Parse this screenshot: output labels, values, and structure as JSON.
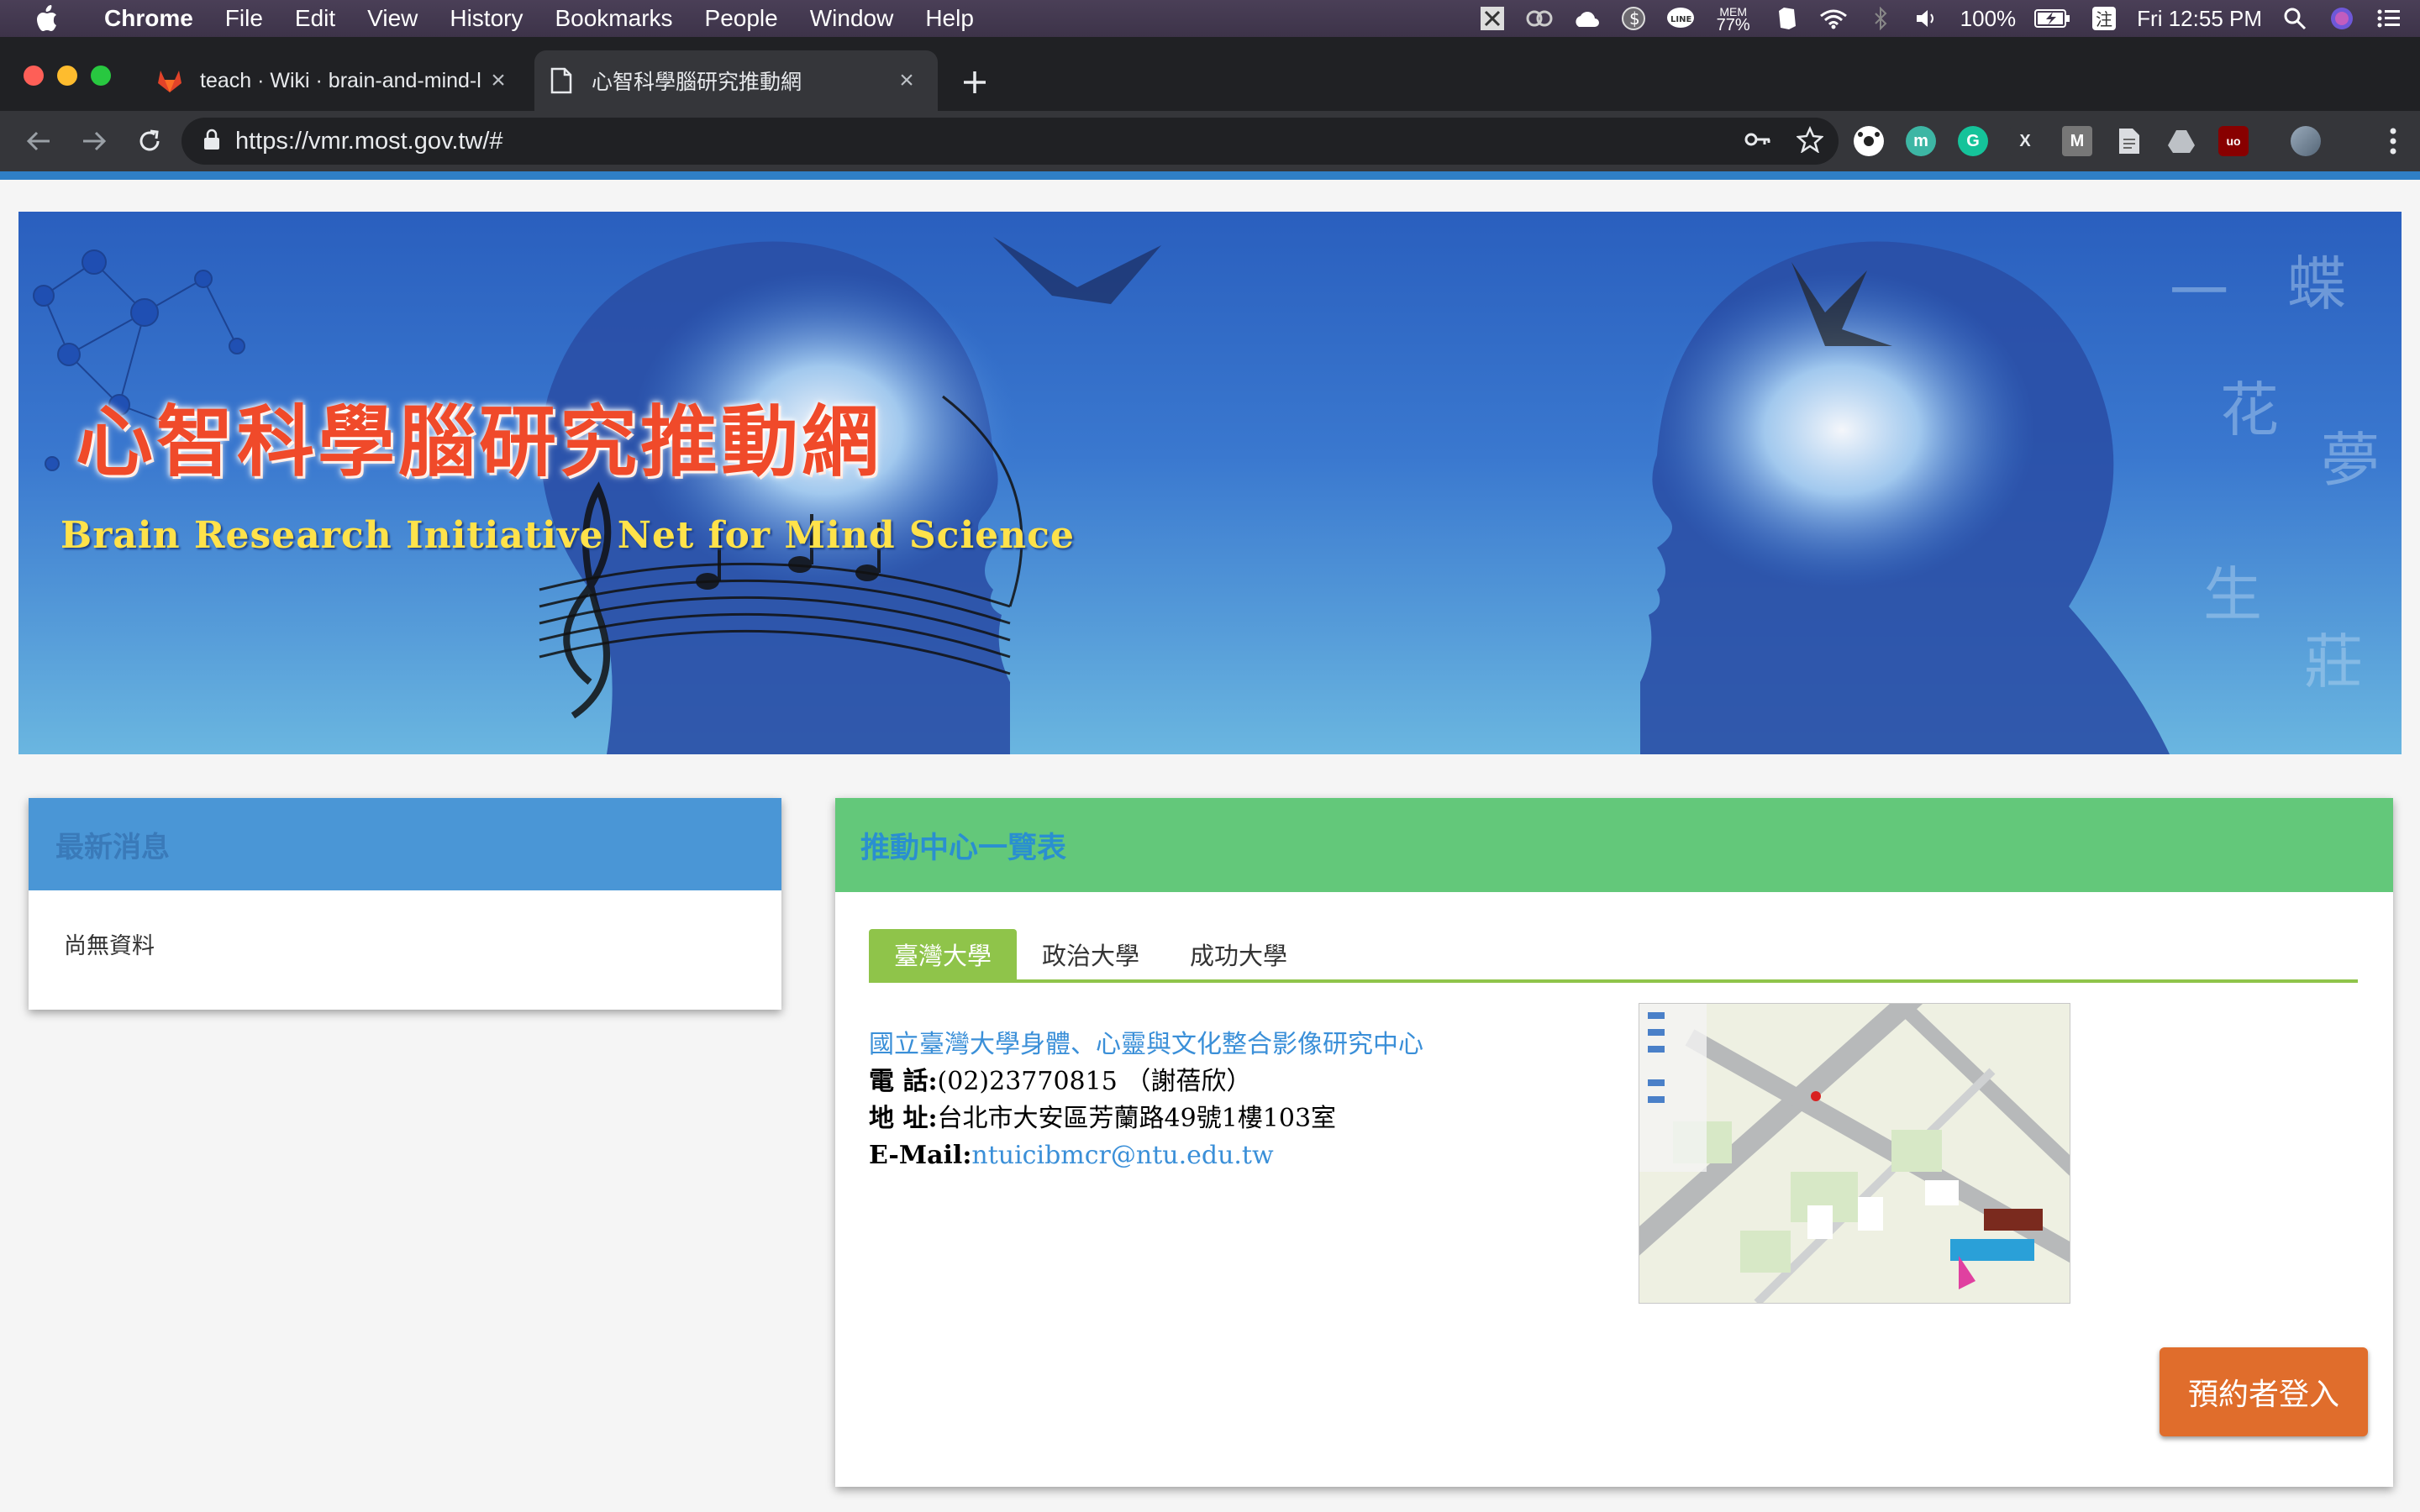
{
  "menubar": {
    "app": "Chrome",
    "items": [
      "File",
      "Edit",
      "View",
      "History",
      "Bookmarks",
      "People",
      "Window",
      "Help"
    ],
    "mem": "MEM",
    "mem_value": "77%",
    "battery": "100%",
    "clock": "Fri 12:55 PM"
  },
  "tabs": [
    {
      "title": "teach · Wiki · brain-and-mind-l",
      "favicon": "gitlab-icon"
    },
    {
      "title": "心智科學腦研究推動網",
      "favicon": "document-icon"
    }
  ],
  "toolbar": {
    "url": "https://vmr.most.gov.tw/#"
  },
  "banner": {
    "title": "心智科學腦研究推動網",
    "subtitle": "Brain Research Initiative Net for Mind Science"
  },
  "news": {
    "heading": "最新消息",
    "empty_text": "尚無資料"
  },
  "centers": {
    "heading": "推動中心一覽表",
    "tabs": [
      "臺灣大學",
      "政治大學",
      "成功大學"
    ],
    "active_tab": 0,
    "name": "國立臺灣大學身體、心靈與文化整合影像研究中心",
    "phone_label": "電 話:",
    "phone_value": "(02)23770815 （謝蓓欣）",
    "address_label": "地 址:",
    "address_value": "台北市大安區芳蘭路49號1樓103室",
    "email_label": "E-Mail:",
    "email_value": "ntuicibmcr@ntu.edu.tw"
  },
  "login_button": "預約者登入",
  "colors": {
    "news_header": "#4a96d6",
    "center_header": "#63c87a",
    "tab_active": "#8fc44a",
    "login_button": "#e06d2c",
    "link": "#3a8fd8"
  }
}
